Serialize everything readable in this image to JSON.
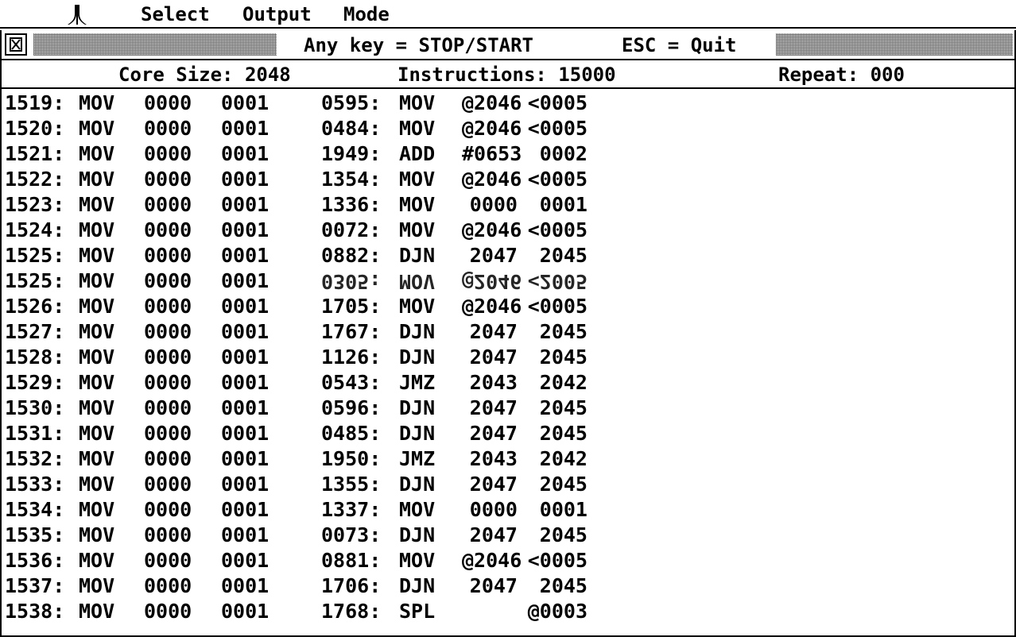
{
  "menubar": {
    "logo_icon": "atari-fuji-icon",
    "items": [
      "Select",
      "Output",
      "Mode"
    ]
  },
  "window": {
    "close_icon": "close-box-icon",
    "title": "Any key = STOP/START",
    "title_right": "ESC = Quit"
  },
  "status": {
    "core_size": "Core Size: 2048",
    "instructions": "Instructions: 15000",
    "repeat": "Repeat: 000"
  },
  "rows": [
    {
      "addr1": "1519:",
      "op1": "MOV",
      "a1": "0000",
      "b1": "0001",
      "addr2": "0595:",
      "op2": "MOV",
      "a2": "@2046",
      "b2": "<0005"
    },
    {
      "addr1": "1520:",
      "op1": "MOV",
      "a1": "0000",
      "b1": "0001",
      "addr2": "0484:",
      "op2": "MOV",
      "a2": "@2046",
      "b2": "<0005"
    },
    {
      "addr1": "1521:",
      "op1": "MOV",
      "a1": "0000",
      "b1": "0001",
      "addr2": "1949:",
      "op2": "ADD",
      "a2": "#0653",
      "b2": "0002"
    },
    {
      "addr1": "1522:",
      "op1": "MOV",
      "a1": "0000",
      "b1": "0001",
      "addr2": "1354:",
      "op2": "MOV",
      "a2": "@2046",
      "b2": "<0005"
    },
    {
      "addr1": "1523:",
      "op1": "MOV",
      "a1": "0000",
      "b1": "0001",
      "addr2": "1336:",
      "op2": "MOV",
      "a2": "0000",
      "b2": "0001"
    },
    {
      "addr1": "1524:",
      "op1": "MOV",
      "a1": "0000",
      "b1": "0001",
      "addr2": "0072:",
      "op2": "MOV",
      "a2": "@2046",
      "b2": "<0005"
    },
    {
      "addr1": "1525:",
      "op1": "MOV",
      "a1": "0000",
      "b1": "0001",
      "addr2": "0882:",
      "op2": "DJN",
      "a2": "2047",
      "b2": "2045"
    },
    {
      "addr1": "1525:",
      "op1": "MOV",
      "a1": "0000",
      "b1": "0001",
      "addr2": "0305:",
      "op2": "MOV",
      "a2": "@2046",
      "b2": "<2005",
      "glitch": true
    },
    {
      "addr1": "1526:",
      "op1": "MOV",
      "a1": "0000",
      "b1": "0001",
      "addr2": "1705:",
      "op2": "MOV",
      "a2": "@2046",
      "b2": "<0005"
    },
    {
      "addr1": "1527:",
      "op1": "MOV",
      "a1": "0000",
      "b1": "0001",
      "addr2": "1767:",
      "op2": "DJN",
      "a2": "2047",
      "b2": "2045"
    },
    {
      "addr1": "1528:",
      "op1": "MOV",
      "a1": "0000",
      "b1": "0001",
      "addr2": "1126:",
      "op2": "DJN",
      "a2": "2047",
      "b2": "2045"
    },
    {
      "addr1": "1529:",
      "op1": "MOV",
      "a1": "0000",
      "b1": "0001",
      "addr2": "0543:",
      "op2": "JMZ",
      "a2": "2043",
      "b2": "2042"
    },
    {
      "addr1": "1530:",
      "op1": "MOV",
      "a1": "0000",
      "b1": "0001",
      "addr2": "0596:",
      "op2": "DJN",
      "a2": "2047",
      "b2": "2045"
    },
    {
      "addr1": "1531:",
      "op1": "MOV",
      "a1": "0000",
      "b1": "0001",
      "addr2": "0485:",
      "op2": "DJN",
      "a2": "2047",
      "b2": "2045"
    },
    {
      "addr1": "1532:",
      "op1": "MOV",
      "a1": "0000",
      "b1": "0001",
      "addr2": "1950:",
      "op2": "JMZ",
      "a2": "2043",
      "b2": "2042"
    },
    {
      "addr1": "1533:",
      "op1": "MOV",
      "a1": "0000",
      "b1": "0001",
      "addr2": "1355:",
      "op2": "DJN",
      "a2": "2047",
      "b2": "2045"
    },
    {
      "addr1": "1534:",
      "op1": "MOV",
      "a1": "0000",
      "b1": "0001",
      "addr2": "1337:",
      "op2": "MOV",
      "a2": "0000",
      "b2": "0001"
    },
    {
      "addr1": "1535:",
      "op1": "MOV",
      "a1": "0000",
      "b1": "0001",
      "addr2": "0073:",
      "op2": "DJN",
      "a2": "2047",
      "b2": "2045"
    },
    {
      "addr1": "1536:",
      "op1": "MOV",
      "a1": "0000",
      "b1": "0001",
      "addr2": "0881:",
      "op2": "MOV",
      "a2": "@2046",
      "b2": "<0005"
    },
    {
      "addr1": "1537:",
      "op1": "MOV",
      "a1": "0000",
      "b1": "0001",
      "addr2": "1706:",
      "op2": "DJN",
      "a2": "2047",
      "b2": "2045"
    },
    {
      "addr1": "1538:",
      "op1": "MOV",
      "a1": "0000",
      "b1": "0001",
      "addr2": "1768:",
      "op2": "SPL",
      "a2": "",
      "b2": "@0003"
    }
  ]
}
